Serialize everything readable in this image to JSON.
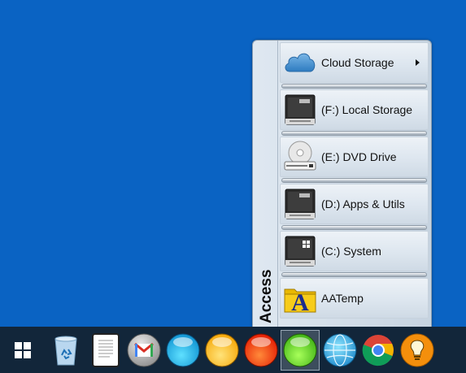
{
  "menu": {
    "title": "Access",
    "items": [
      {
        "label": "Cloud Storage",
        "icon": "cloud-icon",
        "has_submenu": true
      },
      {
        "label": "(F:) Local Storage",
        "icon": "hard-drive-icon"
      },
      {
        "label": "(E:) DVD Drive",
        "icon": "dvd-drive-icon"
      },
      {
        "label": "(D:) Apps & Utils",
        "icon": "hard-drive-icon"
      },
      {
        "label": "(C:) System",
        "icon": "system-drive-icon"
      },
      {
        "label": "AATemp",
        "icon": "folder-icon"
      }
    ]
  },
  "taskbar": {
    "items": [
      {
        "icon": "windows-start-icon"
      },
      {
        "icon": "recycle-bin-icon"
      },
      {
        "icon": "document-icon"
      },
      {
        "icon": "gmail-icon"
      },
      {
        "icon": "blue-orb-icon"
      },
      {
        "icon": "yellow-orb-icon"
      },
      {
        "icon": "red-orb-icon"
      },
      {
        "icon": "green-orb-icon",
        "active": true
      },
      {
        "icon": "globe-icon"
      },
      {
        "icon": "chrome-icon"
      },
      {
        "icon": "lightbulb-icon"
      }
    ]
  },
  "colors": {
    "desktop": "#0a63c3",
    "taskbar": "#12263a",
    "menu_bg": "#d6e0ea"
  }
}
